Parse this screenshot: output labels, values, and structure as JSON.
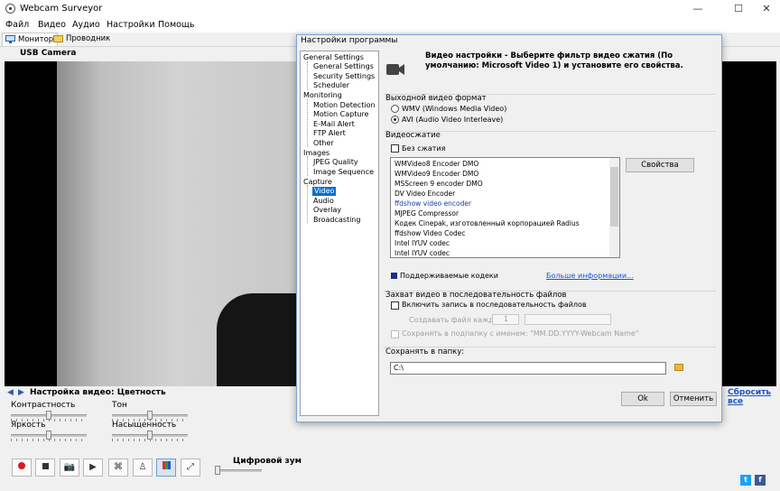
{
  "window": {
    "title": "Webcam Surveyor",
    "minimize": "—",
    "maximize": "☐",
    "close": "✕"
  },
  "menu": [
    "Файл",
    "Видео",
    "Аудио",
    "Настройки",
    "Помощь"
  ],
  "tabs": [
    {
      "label": "Монитор",
      "active": true
    },
    {
      "label": "Проводник",
      "active": false
    }
  ],
  "camera": {
    "title": "USB Camera"
  },
  "video_settings": {
    "title": "Настройка видео: Цветность",
    "reset_all": "Сбросить все",
    "sliders": [
      {
        "label": "Контрастность",
        "value": 0.5
      },
      {
        "label": "Тон",
        "value": 0.5
      },
      {
        "label": "Яркость",
        "value": 0.5
      },
      {
        "label": "Насыщенность",
        "value": 0.5
      }
    ],
    "digital_zoom_label": "Цифровой зум",
    "digital_zoom_value": 0.0
  },
  "toolbar": [
    "record-icon",
    "stop-icon",
    "snapshot-icon",
    "playback-icon",
    "motion-detection-icon",
    "person-icon",
    "color-settings-icon",
    "fullscreen-icon"
  ],
  "social": [
    {
      "label": "t",
      "color": "#1da1f2"
    },
    {
      "label": "f",
      "color": "#3b5998"
    }
  ],
  "dialog": {
    "title": "Настройки программы",
    "description": "Видео настройки - Выберите фильтр видео сжатия (По умолчанию: Microsoft Video 1) и установите его свойства.",
    "tree": {
      "general_settings": "General Settings",
      "general_settings_child": "General Settings",
      "security_settings": "Security Settings",
      "scheduler": "Scheduler",
      "monitoring": "Monitoring",
      "motion_detection": "Motion Detection",
      "motion_capture": "Motion Capture",
      "email_alert": "E-Mail Alert",
      "ftp_alert": "FTP Alert",
      "other": "Other",
      "images": "Images",
      "jpeg_quality": "JPEG Quality",
      "image_sequence": "Image Sequence",
      "capture": "Capture",
      "video": "Video",
      "audio": "Audio",
      "overlay": "Overlay",
      "broadcasting": "Broadcasting"
    },
    "output_format": {
      "label": "Выходной видео формат",
      "options": [
        {
          "label": "WMV (Windows Media Video)",
          "selected": false
        },
        {
          "label": "AVI (Audio Video Interleave)",
          "selected": true
        }
      ]
    },
    "compression": {
      "label": "Видеосжатие",
      "no_compression": "Без сжатия",
      "codecs": [
        {
          "name": "WMVideo8 Encoder DMO",
          "highlight": false
        },
        {
          "name": "WMVideo9 Encoder DMO",
          "highlight": false
        },
        {
          "name": "MSScreen 9 encoder DMO",
          "highlight": false
        },
        {
          "name": "DV Video Encoder",
          "highlight": false
        },
        {
          "name": "ffdshow video encoder",
          "highlight": true
        },
        {
          "name": "MJPEG Compressor",
          "highlight": false
        },
        {
          "name": "Кодек Cinepak, изготовленный корпорацией Radius",
          "highlight": false
        },
        {
          "name": "ffdshow Video Codec",
          "highlight": false
        },
        {
          "name": "Intel IYUV codec",
          "highlight": false
        },
        {
          "name": "Intel IYUV codec",
          "highlight": false
        }
      ],
      "properties_button": "Свойства",
      "supported_label": "Поддерживаемые кодеки",
      "more_info": "Больше информации..."
    },
    "sequence": {
      "label": "Захват видео в последовательность файлов",
      "enable": "Включить запись в последовательность файлов",
      "create_every": "Создавать файл каждые:",
      "interval": "1",
      "save_subfolder": "Сохранять в подпапку с именем: \"MM.DD.YYYY-Webcam Name\""
    },
    "save_folder": {
      "label": "Сохранять в папку:",
      "path": "C:\\"
    },
    "ok": "Ok",
    "cancel": "Отменить"
  }
}
